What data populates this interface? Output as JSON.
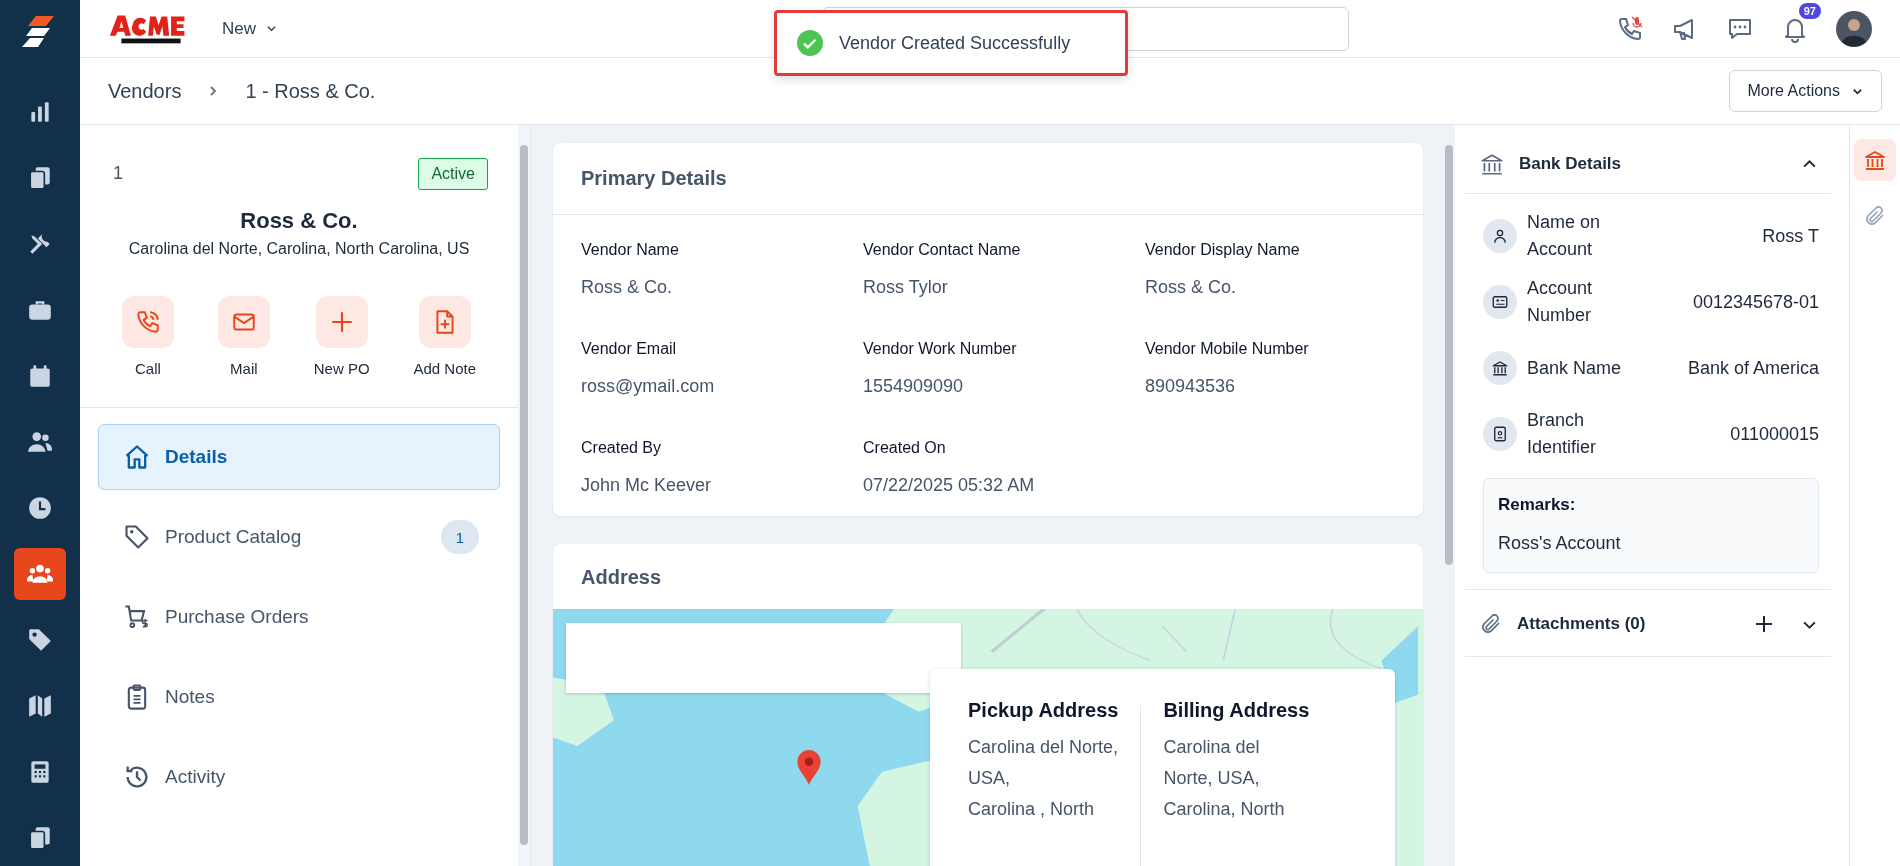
{
  "side_nav": [
    {
      "selected": false
    },
    {
      "selected": false
    },
    {
      "selected": false
    },
    {
      "selected": false
    },
    {
      "selected": false
    },
    {
      "selected": false
    },
    {
      "selected": false
    },
    {
      "selected": true
    },
    {
      "selected": false
    },
    {
      "selected": false
    },
    {
      "selected": false
    },
    {
      "selected": false
    }
  ],
  "top_bar": {
    "new_menu": "New",
    "notification_count": "97"
  },
  "toast": {
    "message": "Vendor Created Successfully"
  },
  "breadcrumb": [
    "Vendors",
    "1 - Ross & Co."
  ],
  "more_actions": "More Actions",
  "vendor": {
    "number": "1",
    "status": "Active",
    "name": "Ross & Co.",
    "address": "Carolina del Norte, Carolina, North Carolina, US"
  },
  "actions": [
    {
      "label": "Call"
    },
    {
      "label": "Mail"
    },
    {
      "label": "New PO"
    },
    {
      "label": "Add Note"
    }
  ],
  "menu": [
    {
      "label": "Details",
      "selected": true
    },
    {
      "label": "Product Catalog",
      "selected": false,
      "count": "1"
    },
    {
      "label": "Purchase Orders",
      "selected": false
    },
    {
      "label": "Notes",
      "selected": false
    },
    {
      "label": "Activity",
      "selected": false
    }
  ],
  "primary_details": {
    "title": "Primary Details",
    "fields": [
      {
        "label": "Vendor Name",
        "value": "Ross & Co."
      },
      {
        "label": "Vendor Contact Name",
        "value": "Ross Tylor"
      },
      {
        "label": "Vendor Display Name",
        "value": "Ross & Co."
      },
      {
        "label": "Vendor Email",
        "value": "ross@ymail.com"
      },
      {
        "label": "Vendor Work Number",
        "value": "1554909090"
      },
      {
        "label": "Vendor Mobile Number",
        "value": "890943536"
      },
      {
        "label": "Created By",
        "value": "John Mc Keever"
      },
      {
        "label": "Created On",
        "value": "07/22/2025 05:32 AM"
      }
    ]
  },
  "address": {
    "title": "Address",
    "cards": [
      {
        "title": "Pickup Address",
        "lines": [
          "Carolina del Norte,",
          "USA,",
          "Carolina , North"
        ]
      },
      {
        "title": "Billing Address",
        "lines": [
          "Carolina del",
          "Norte, USA,",
          "Carolina, North"
        ]
      }
    ]
  },
  "bank_details": {
    "title": "Bank Details",
    "expanded": true,
    "rows": [
      {
        "label": "Name on Account",
        "value": "Ross T"
      },
      {
        "label": "Account Number",
        "value": "0012345678-01"
      },
      {
        "label": "Bank Name",
        "value": "Bank of America"
      },
      {
        "label": "Branch Identifier",
        "value": "011000015"
      }
    ],
    "remarks": {
      "label": "Remarks:",
      "text": "Ross's Account"
    }
  },
  "attachments": {
    "title": "Attachments (0)",
    "expanded": false
  },
  "right_rail": [
    {
      "selected": true
    },
    {
      "selected": false
    }
  ]
}
